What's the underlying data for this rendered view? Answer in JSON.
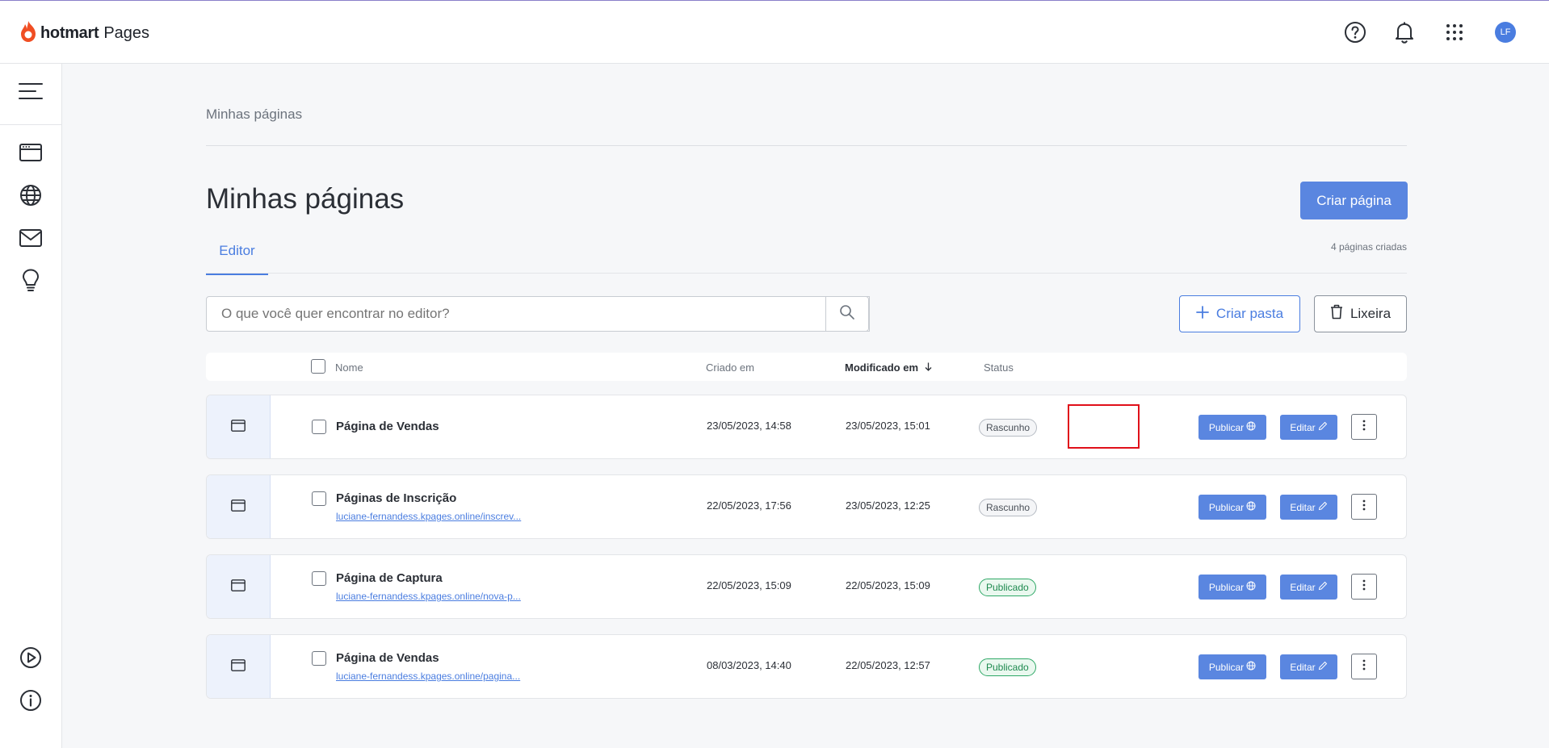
{
  "header": {
    "brand": "hotmart",
    "product": "Pages",
    "avatar_initials": "LF",
    "icons": [
      "help-icon",
      "bell-icon",
      "apps-grid-icon"
    ]
  },
  "sidebar": {
    "items": [
      "menu-icon",
      "pages-icon",
      "globe-icon",
      "mail-icon",
      "lightbulb-icon",
      "play-icon",
      "info-icon"
    ]
  },
  "main": {
    "breadcrumb": "Minhas páginas",
    "title": "Minhas páginas",
    "create_page_label": "Criar página",
    "tab_label": "Editor",
    "pages_count": "4 páginas criadas",
    "search_placeholder": "O que você quer encontrar no editor?",
    "create_folder_label": "Criar pasta",
    "trash_label": "Lixeira"
  },
  "table": {
    "columns": {
      "name": "Nome",
      "created": "Criado em",
      "modified": "Modificado em",
      "status": "Status"
    },
    "rows": [
      {
        "name": "Página de Vendas",
        "url": "",
        "created": "23/05/2023, 14:58",
        "modified": "23/05/2023, 15:01",
        "status": "Rascunho"
      },
      {
        "name": "Páginas de Inscrição",
        "url": "luciane-fernandess.kpages.online/inscrev...",
        "created": "22/05/2023, 17:56",
        "modified": "23/05/2023, 12:25",
        "status": "Rascunho"
      },
      {
        "name": "Página de Captura",
        "url": "luciane-fernandess.kpages.online/nova-p...",
        "created": "22/05/2023, 15:09",
        "modified": "22/05/2023, 15:09",
        "status": "Publicado"
      },
      {
        "name": "Página de Vendas",
        "url": "luciane-fernandess.kpages.online/pagina...",
        "created": "08/03/2023, 14:40",
        "modified": "22/05/2023, 12:57",
        "status": "Publicado"
      }
    ],
    "publish_label": "Publicar",
    "edit_label": "Editar"
  },
  "colors": {
    "accent": "#5a86e0",
    "brand_flame": "#f04e23",
    "published": "#2ea866",
    "highlight": "#e0101a"
  }
}
